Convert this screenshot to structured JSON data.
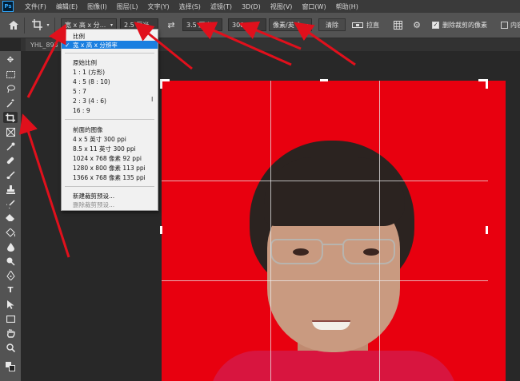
{
  "app": {
    "logo": "Ps"
  },
  "menubar": {
    "items": [
      "文件(F)",
      "编辑(E)",
      "图像(I)",
      "图层(L)",
      "文字(Y)",
      "选择(S)",
      "滤镜(T)",
      "3D(D)",
      "视图(V)",
      "窗口(W)",
      "帮助(H)"
    ]
  },
  "options": {
    "ratio_value": "宽 x 高 x 分...",
    "width_value": "2.5 厘米",
    "height_value": "3.5 厘米",
    "resolution_value": "300",
    "unit_value": "像素/英寸",
    "clear_label": "清除",
    "straighten_label": "拉直",
    "delete_cropped_label": "删除裁剪的像素",
    "content_aware_label": "内容",
    "delete_cropped_checked": true
  },
  "document": {
    "tab_label": "YHL_893"
  },
  "dropdown": {
    "items": [
      {
        "label": "比例",
        "type": "item"
      },
      {
        "label": "宽 x 高 x 分辨率",
        "type": "selected"
      },
      {
        "type": "sep"
      },
      {
        "label": "原始比例",
        "type": "item"
      },
      {
        "label": "1 : 1 (方形)",
        "type": "item"
      },
      {
        "label": "4 : 5 (8 : 10)",
        "type": "item"
      },
      {
        "label": "5 : 7",
        "type": "item"
      },
      {
        "label": "2 : 3 (4 : 6)",
        "type": "item"
      },
      {
        "label": "16 : 9",
        "type": "item"
      },
      {
        "type": "sep"
      },
      {
        "label": "前面的图像",
        "type": "item"
      },
      {
        "label": "4 x 5 英寸 300 ppi",
        "type": "item"
      },
      {
        "label": "8.5 x 11 英寸 300 ppi",
        "type": "item"
      },
      {
        "label": "1024 x 768 像素 92 ppi",
        "type": "item"
      },
      {
        "label": "1280 x 800 像素 113 ppi",
        "type": "item"
      },
      {
        "label": "1366 x 768 像素 135 ppi",
        "type": "item"
      },
      {
        "type": "sep"
      },
      {
        "label": "新建裁剪预设...",
        "type": "item"
      },
      {
        "label": "删除裁剪预设...",
        "type": "disabled"
      }
    ]
  },
  "tools": [
    "move-icon",
    "marquee-icon",
    "lasso-icon",
    "magic-wand-icon",
    "crop-icon",
    "frame-icon",
    "eyedropper-icon",
    "healing-icon",
    "brush-icon",
    "stamp-icon",
    "history-brush-icon",
    "eraser-icon",
    "bucket-icon",
    "blur-icon",
    "dodge-icon",
    "pen-icon",
    "type-icon",
    "path-select-icon",
    "rectangle-icon",
    "hand-icon",
    "zoom-icon"
  ],
  "colors": {
    "accent": "#1a7fe0",
    "background_red": "#e8000f",
    "annotation_arrow": "#e0101c"
  }
}
